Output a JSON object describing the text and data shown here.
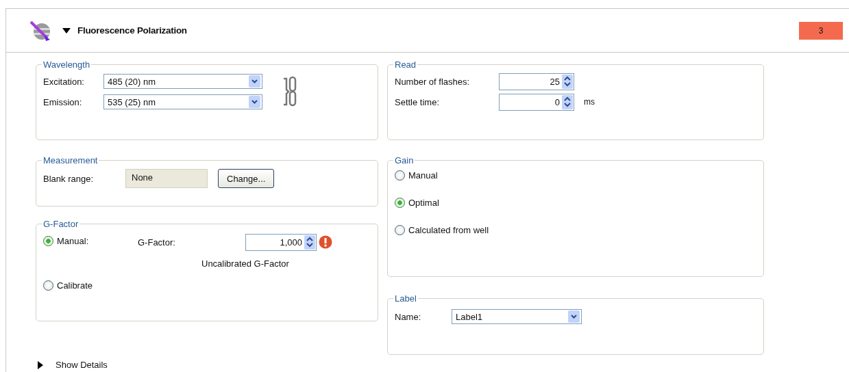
{
  "header": {
    "title": "Fluorescence Polarization",
    "expanded": true,
    "badge": "3"
  },
  "wavelength": {
    "title": "Wavelength",
    "rows": [
      {
        "label": "Excitation:",
        "value": "485 (20) nm"
      },
      {
        "label": "Emission:",
        "value": "535 (25) nm"
      }
    ]
  },
  "measurement": {
    "title": "Measurement",
    "label": "Blank range:",
    "value": "None",
    "button": "Change..."
  },
  "g_factor": {
    "title": "G-Factor",
    "options": [
      {
        "label": "Manual:",
        "selected": true
      },
      {
        "label": "Calibrate",
        "selected": false
      }
    ],
    "field_label": "G-Factor:",
    "value": "1,000",
    "warning": true,
    "note": "Uncalibrated G-Factor"
  },
  "read": {
    "title": "Read",
    "rows": [
      {
        "label": "Number of flashes:",
        "value": "25"
      },
      {
        "label": "Settle time:",
        "value": "0",
        "unit": "ms"
      }
    ]
  },
  "gain": {
    "title": "Gain",
    "options": [
      {
        "label": "Manual",
        "selected": false
      },
      {
        "label": "Optimal",
        "selected": true
      },
      {
        "label": "Calculated from well",
        "selected": false
      }
    ]
  },
  "label": {
    "title": "Label",
    "field_label": "Name:",
    "value": "Label1"
  },
  "details": {
    "label": "Show Details",
    "expanded": false
  }
}
